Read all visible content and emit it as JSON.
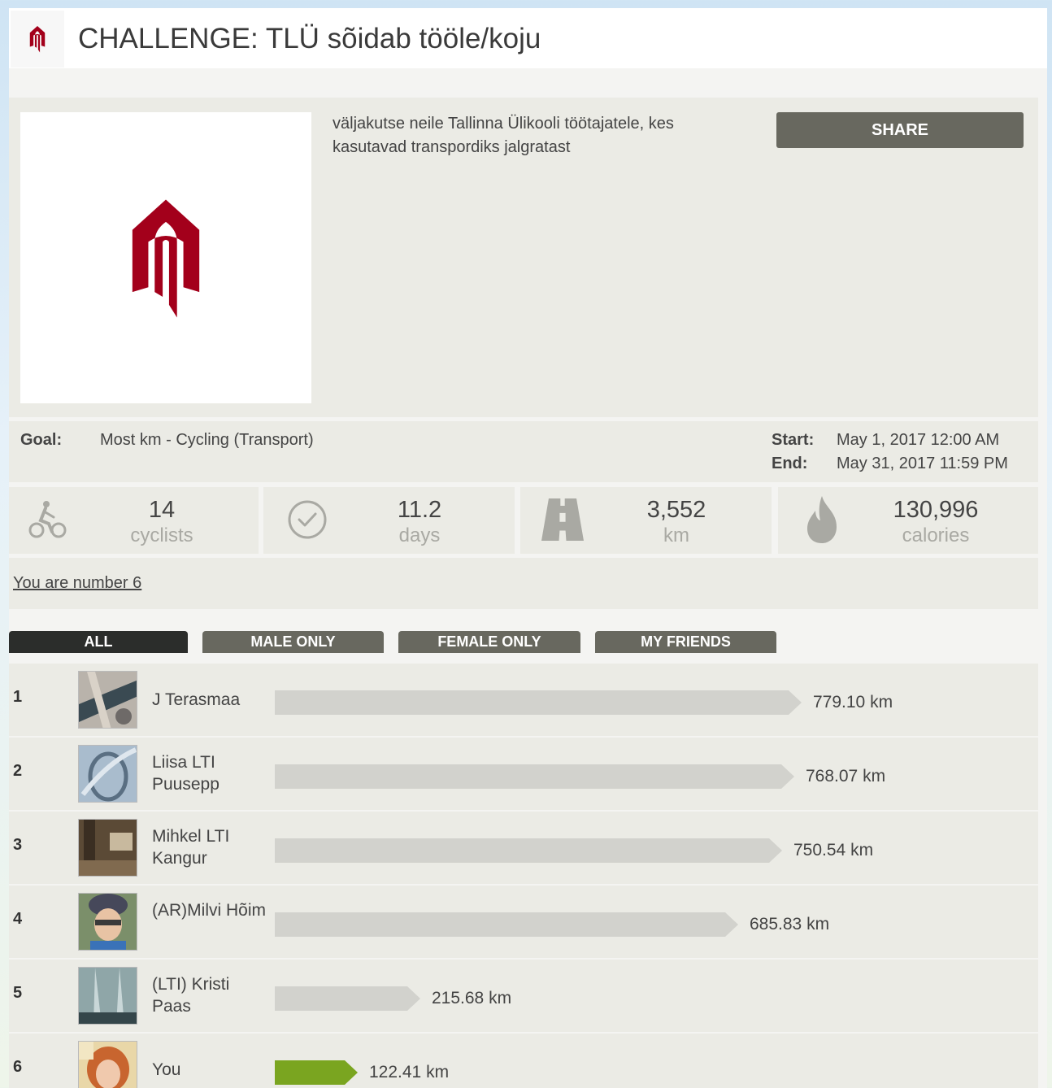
{
  "header": {
    "title": "CHALLENGE:  TLÜ sõidab tööle/koju"
  },
  "info": {
    "description": "väljakutse neile Tallinna Ülikooli töötajatele, kes kasutavad transpordiks jalgratast",
    "share_label": "SHARE"
  },
  "details": {
    "goal_label": "Goal:",
    "goal_value": "Most km - Cycling (Transport)",
    "start_label": "Start:",
    "start_value": "May 1, 2017 12:00 AM",
    "end_label": "End:",
    "end_value": "May 31, 2017 11:59 PM"
  },
  "stats": [
    {
      "icon": "cyclist-icon",
      "value": "14",
      "unit": "cyclists"
    },
    {
      "icon": "checkmark-icon",
      "value": "11.2",
      "unit": "days"
    },
    {
      "icon": "road-icon",
      "value": "3,552",
      "unit": "km"
    },
    {
      "icon": "flame-icon",
      "value": "130,996",
      "unit": "calories"
    }
  ],
  "rank_text": "You are number 6",
  "filters": [
    "ALL",
    "MALE ONLY",
    "FEMALE ONLY",
    "MY FRIENDS"
  ],
  "leaderboard": {
    "max_km": 779.1,
    "rows": [
      {
        "rank": "1",
        "name": "J Terasmaa",
        "km": 779.1,
        "distance": "779.10 km",
        "highlight": false
      },
      {
        "rank": "2",
        "name": "Liisa LTI Puusepp",
        "km": 768.07,
        "distance": "768.07 km",
        "highlight": false
      },
      {
        "rank": "3",
        "name": "Mihkel LTI Kangur",
        "km": 750.54,
        "distance": "750.54 km",
        "highlight": false
      },
      {
        "rank": "4",
        "name": "(AR)Milvi Hõim",
        "km": 685.83,
        "distance": "685.83 km",
        "highlight": false
      },
      {
        "rank": "5",
        "name": "(LTI) Kristi Paas",
        "km": 215.68,
        "distance": "215.68 km",
        "highlight": false
      },
      {
        "rank": "6",
        "name": "You",
        "km": 122.41,
        "distance": "122.41 km",
        "highlight": true
      }
    ]
  },
  "colors": {
    "brand": "#a3001b",
    "bar": "#d2d2cd",
    "bar_highlight": "#7aa520",
    "tab_active": "#2b2d2b",
    "tab": "#68685f"
  }
}
